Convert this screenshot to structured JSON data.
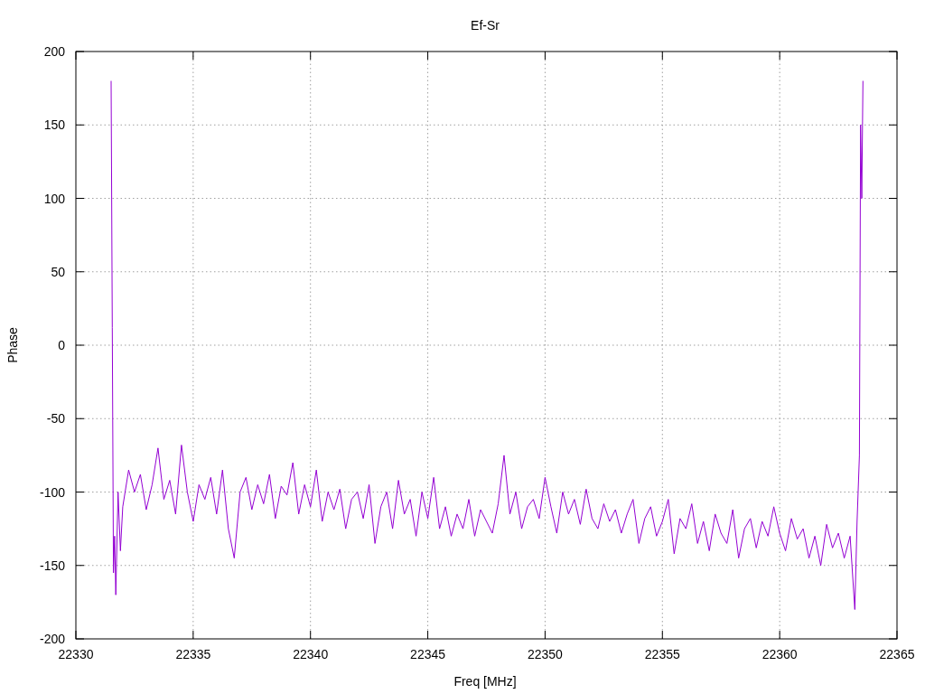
{
  "chart_data": {
    "type": "line",
    "grid": true,
    "title": "Ef-Sr",
    "xlabel": "Freq [MHz]",
    "ylabel": "Phase",
    "xlim": [
      22330,
      22365
    ],
    "ylim": [
      -200,
      200
    ],
    "xticks": [
      22330,
      22335,
      22340,
      22345,
      22350,
      22355,
      22360,
      22365
    ],
    "yticks": [
      -200,
      -150,
      -100,
      -50,
      0,
      50,
      100,
      150,
      200
    ],
    "x": [
      22331.5,
      22331.55,
      22331.6,
      22331.65,
      22331.7,
      22331.8,
      22331.9,
      22332,
      22332.25,
      22332.5,
      22332.75,
      22333,
      22333.25,
      22333.5,
      22333.75,
      22334,
      22334.25,
      22334.5,
      22334.75,
      22335,
      22335.25,
      22335.5,
      22335.75,
      22336,
      22336.25,
      22336.5,
      22336.75,
      22337,
      22337.25,
      22337.5,
      22337.75,
      22338,
      22338.25,
      22338.5,
      22338.75,
      22339,
      22339.25,
      22339.5,
      22339.75,
      22340,
      22340.25,
      22340.5,
      22340.75,
      22341,
      22341.25,
      22341.5,
      22341.75,
      22342,
      22342.25,
      22342.5,
      22342.75,
      22343,
      22343.25,
      22343.5,
      22343.75,
      22344,
      22344.25,
      22344.5,
      22344.75,
      22345,
      22345.25,
      22345.5,
      22345.75,
      22346,
      22346.25,
      22346.5,
      22346.75,
      22347,
      22347.25,
      22347.5,
      22347.75,
      22348,
      22348.25,
      22348.5,
      22348.75,
      22349,
      22349.25,
      22349.5,
      22349.75,
      22350,
      22350.25,
      22350.5,
      22350.75,
      22351,
      22351.25,
      22351.5,
      22351.75,
      22352,
      22352.25,
      22352.5,
      22352.75,
      22353,
      22353.25,
      22353.5,
      22353.75,
      22354,
      22354.25,
      22354.5,
      22354.75,
      22355,
      22355.25,
      22355.5,
      22355.75,
      22356,
      22356.25,
      22356.5,
      22356.75,
      22357,
      22357.25,
      22357.5,
      22357.75,
      22358,
      22358.25,
      22358.5,
      22358.75,
      22359,
      22359.25,
      22359.5,
      22359.75,
      22360,
      22360.25,
      22360.5,
      22360.75,
      22361,
      22361.25,
      22361.5,
      22361.75,
      22362,
      22362.25,
      22362.5,
      22362.75,
      22363,
      22363.2,
      22363.3,
      22363.4,
      22363.45,
      22363.5,
      22363.55
    ],
    "series": [
      {
        "color": "#9400d3",
        "values": [
          180,
          12,
          -155,
          -130,
          -170,
          -100,
          -140,
          -110,
          -85,
          -100,
          -88,
          -112,
          -95,
          -70,
          -105,
          -92,
          -115,
          -68,
          -100,
          -120,
          -95,
          -105,
          -90,
          -115,
          -85,
          -125,
          -145,
          -100,
          -90,
          -112,
          -95,
          -108,
          -88,
          -118,
          -96,
          -102,
          -80,
          -115,
          -95,
          -110,
          -85,
          -120,
          -100,
          -112,
          -98,
          -125,
          -105,
          -100,
          -118,
          -95,
          -135,
          -110,
          -100,
          -125,
          -92,
          -115,
          -105,
          -130,
          -100,
          -118,
          -90,
          -125,
          -110,
          -130,
          -115,
          -125,
          -105,
          -130,
          -112,
          -120,
          -128,
          -108,
          -75,
          -115,
          -100,
          -125,
          -110,
          -105,
          -118,
          -90,
          -110,
          -128,
          -100,
          -115,
          -105,
          -122,
          -98,
          -118,
          -125,
          -108,
          -120,
          -112,
          -128,
          -115,
          -105,
          -135,
          -118,
          -110,
          -130,
          -120,
          -105,
          -142,
          -118,
          -125,
          -108,
          -135,
          -120,
          -140,
          -115,
          -128,
          -135,
          -112,
          -145,
          -125,
          -118,
          -138,
          -120,
          -130,
          -110,
          -128,
          -140,
          -118,
          -132,
          -125,
          -145,
          -130,
          -150,
          -122,
          -138,
          -128,
          -145,
          -130,
          -180,
          -120,
          -75,
          150,
          100,
          180
        ]
      }
    ]
  }
}
